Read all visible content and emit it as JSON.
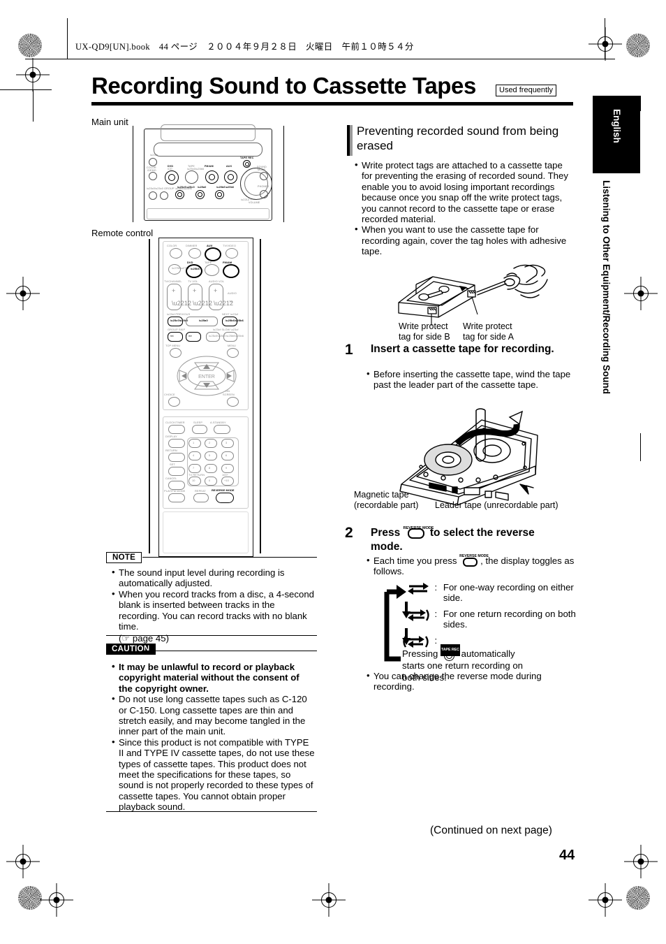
{
  "file_header": "UX-QD9[UN].book　44 ページ　２００４年９月２８日　火曜日　午前１０時５４分",
  "title": "Recording Sound to Cassette Tapes",
  "badge": "Used frequently",
  "left_column": {
    "main_unit_label": "Main unit",
    "remote_label": "Remote control",
    "main_unit_buttons": [
      "COLOR/DEMO",
      "DVD /CD ▶",
      "TAPE ◀▶",
      "FM/AM",
      "AUX",
      "TAPE REC",
      "STANDBY",
      "PHONES",
      "VOLUME",
      "GROUP"
    ],
    "remote_buttons": [
      "COLOR",
      "DIMMER",
      "AUX",
      "TV/VIDEO",
      "DVD",
      "TAPE",
      "FM/AM",
      "TV/CHANNEL",
      "TV VOL",
      "AUDIO VOL",
      "AUDIO",
      "TV",
      "PREVIOUS",
      "NEXT",
      "GROUP SKIP",
      "SLOW",
      "TOP MENU",
      "MENU",
      "ENTER",
      "CHOICE",
      "ON SCREEN",
      "CLOCK/TIMER",
      "SLEEP",
      "A.STANDBY",
      "DISPLAY",
      "RETURN",
      "SET",
      "CANCEL",
      "TV RETURN",
      "100+",
      "PLAY/FM MODE",
      "REPEAT",
      "REVERSE MODE"
    ],
    "keypad": [
      "1",
      "2",
      "3",
      "4",
      "5",
      "6",
      "7",
      "8",
      "9",
      "10",
      "0",
      "+10"
    ],
    "note": {
      "tag": "NOTE",
      "items": [
        "The sound input level during recording is automatically adjusted.",
        "When you record tracks from a disc, a 4-second blank is inserted between tracks in the recording. You can record tracks with no blank time."
      ],
      "reference": "page 45"
    },
    "caution": {
      "tag": "CAUTION",
      "items": [
        {
          "bold": true,
          "text": "It may be unlawful to record or playback copyright material without the consent of the copyright owner."
        },
        {
          "bold": false,
          "text": "Do not use long cassette tapes such as C-120 or C-150. Long cassette tapes are thin and stretch easily, and may become tangled in the inner part of the main unit."
        },
        {
          "bold": false,
          "text": "Since this product is not compatible with TYPE II and TYPE IV cassette tapes, do not use these types of cassette tapes. This product does not meet the specifications for these tapes, so sound is not properly recorded to these types of cassette tapes. You cannot obtain proper playback sound."
        }
      ]
    }
  },
  "right_column": {
    "section_heading": "Preventing recorded sound from being erased",
    "section_bullets": [
      "Write protect tags are attached to a cassette tape for preventing the erasing of recorded sound. They enable you to avoid losing important recordings because once you snap off the write protect tags, you cannot record to the cassette tape or erase recorded material.",
      "When you want to use the cassette tape for recording again, cover the tag holes with adhesive tape."
    ],
    "figure1": {
      "label_b": "Write protect\ntag for side B",
      "label_a": "Write protect\ntag for side A"
    },
    "step1": {
      "number": "1",
      "heading": "Insert a cassette tape for recording.",
      "bullets": [
        "Before inserting the cassette tape, wind the tape past the leader part of the cassette tape."
      ]
    },
    "figure2": {
      "label_left": "Magnetic tape\n(recordable part)",
      "label_right": "Leader tape (unrecordable part)"
    },
    "step2": {
      "number": "2",
      "heading_pre": "Press",
      "heading_post": "to select the reverse",
      "heading_line2": "mode.",
      "button_label": "REVERSE MODE",
      "bullet_pre": "Each time you press",
      "bullet_post": ", the display toggles as follows.",
      "modes": [
        {
          "symbol": "one-way",
          "text": "For one-way recording on either side."
        },
        {
          "symbol": "one-return",
          "text": "For one return recording on both sides."
        },
        {
          "symbol": "auto-return",
          "text_pre": "Pressing",
          "button": "TAPE REC",
          "text_post": "automatically starts one return recording on both sides."
        }
      ],
      "closing_bullet": "You can change the reverse mode during recording."
    }
  },
  "side_tab": {
    "language": "English",
    "chapter": "Listening to Other Equipment/Recording Sound"
  },
  "footer": {
    "continued": "(Continued on next page)",
    "page_number": "44"
  }
}
